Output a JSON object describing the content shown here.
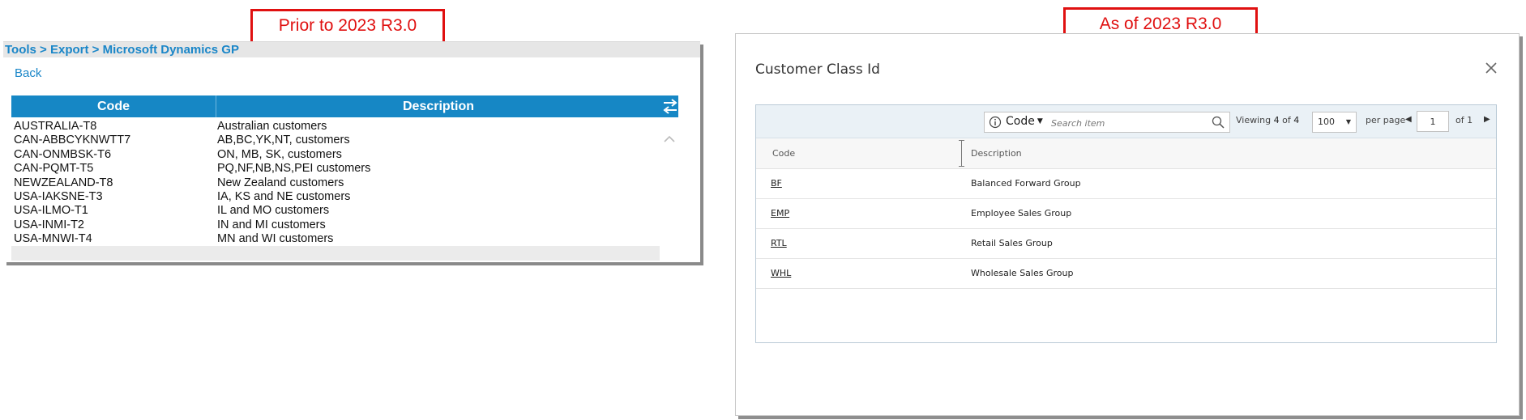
{
  "callouts": {
    "old": "Prior to 2023 R3.0",
    "new": "As of 2023 R3.0"
  },
  "old_ui": {
    "breadcrumb": "Tools > Export > Microsoft Dynamics GP",
    "back_label": "Back",
    "columns": {
      "code": "Code",
      "description": "Description"
    },
    "icons": {
      "swap": "swap-arrows-icon",
      "scroll_up": "chevron-up-icon"
    },
    "header_color": "#1687c5",
    "rows": [
      {
        "code": "AUSTRALIA-T8",
        "description": "Australian customers"
      },
      {
        "code": "CAN-ABBCYKNWTT7",
        "description": "AB,BC,YK,NT, customers"
      },
      {
        "code": "CAN-ONMBSK-T6",
        "description": "ON, MB, SK, customers"
      },
      {
        "code": "CAN-PQMT-T5",
        "description": "PQ,NF,NB,NS,PEI customers"
      },
      {
        "code": "NEWZEALAND-T8",
        "description": "New Zealand customers"
      },
      {
        "code": "USA-IAKSNE-T3",
        "description": "IA, KS and NE customers"
      },
      {
        "code": "USA-ILMO-T1",
        "description": "IL and MO customers"
      },
      {
        "code": "USA-INMI-T2",
        "description": "IN and MI customers"
      },
      {
        "code": "USA-MNWI-T4",
        "description": "MN and WI customers"
      }
    ]
  },
  "new_ui": {
    "title": "Customer Class Id",
    "icons": {
      "close": "close-icon",
      "info": "info-icon",
      "search": "search-icon"
    },
    "toolbar": {
      "search_field_label": "Code",
      "search_placeholder": "Search item",
      "viewing_label": "Viewing",
      "viewing_count": "4",
      "viewing_of": "of",
      "viewing_total": "4",
      "page_size": "100",
      "per_page_label": "per page",
      "page_value": "1",
      "page_of_label": "of 1"
    },
    "columns": {
      "code": "Code",
      "description": "Description"
    },
    "rows": [
      {
        "code": "BF",
        "description": "Balanced Forward Group"
      },
      {
        "code": "EMP",
        "description": "Employee Sales Group"
      },
      {
        "code": "RTL",
        "description": "Retail Sales Group"
      },
      {
        "code": "WHL",
        "description": "Wholesale Sales Group"
      }
    ]
  },
  "colors": {
    "callout_red": "#e01010",
    "link_blue": "#1a86c8"
  }
}
